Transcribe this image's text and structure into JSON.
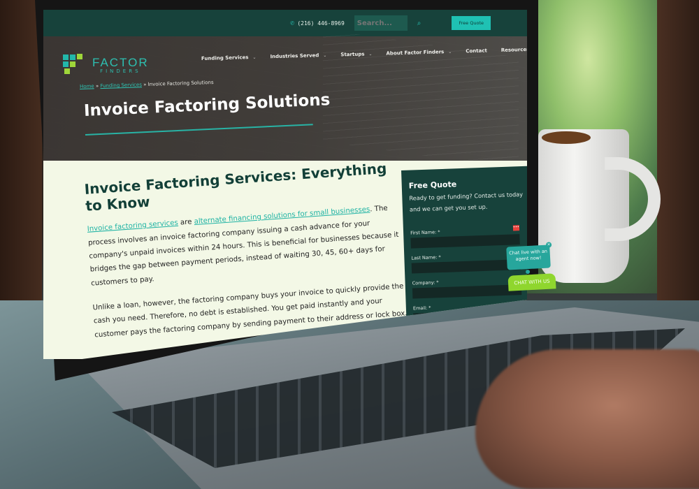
{
  "topbar": {
    "phone": "(216) 446-8969",
    "search_placeholder": "Search...",
    "free_quote_button": "Free Quote"
  },
  "brand": {
    "name_line1": "FACTOR",
    "name_line2": "FINDERS",
    "colors": {
      "teal": "#2dbfb0",
      "lime": "#9fd63a",
      "dark_green": "#17423b"
    }
  },
  "nav": {
    "items": [
      {
        "label": "Funding Services",
        "has_dropdown": true
      },
      {
        "label": "Industries Served",
        "has_dropdown": true
      },
      {
        "label": "Startups",
        "has_dropdown": true
      },
      {
        "label": "About Factor Finders",
        "has_dropdown": true
      },
      {
        "label": "Contact",
        "has_dropdown": false
      },
      {
        "label": "Resources",
        "has_dropdown": true
      }
    ]
  },
  "breadcrumb": {
    "items": [
      "Home",
      "Funding Services"
    ],
    "separator": "»",
    "current": "Invoice Factoring Solutions"
  },
  "hero": {
    "title": "Invoice Factoring Solutions"
  },
  "article": {
    "heading": "Invoice Factoring Services: Everything to Know",
    "p1_link1": "Invoice factoring services",
    "p1_text1": " are ",
    "p1_link2": "alternate financing solutions for small businesses",
    "p1_text2": ". The process involves an invoice factoring company issuing a cash advance for your company's unpaid invoices within 24 hours. This is beneficial for businesses because it bridges the gap between payment periods, instead of waiting 30, 45, 60+ days for customers to pay.",
    "p2": "Unlike a loan, however, the factoring company buys your invoice to quickly provide the cash you need. Therefore, no debt is established. You get paid instantly and your customer pays the factoring company by sending payment to their address or lock box."
  },
  "quote_form": {
    "title": "Free Quote",
    "description": "Ready to get funding? Contact us today and we can get you set up.",
    "fields": [
      {
        "label": "First Name: *",
        "value": ""
      },
      {
        "label": "Last Name: *",
        "value": ""
      },
      {
        "label": "Company: *",
        "value": ""
      },
      {
        "label": "Email: *",
        "value": ""
      }
    ]
  },
  "chat": {
    "bubble_text": "Chat live with an agent now!",
    "close": "×",
    "button_label": "CHAT WITH US"
  },
  "icons": {
    "phone": "✆",
    "search": "⌕",
    "chevron": "⌄",
    "autofill": "•••"
  }
}
